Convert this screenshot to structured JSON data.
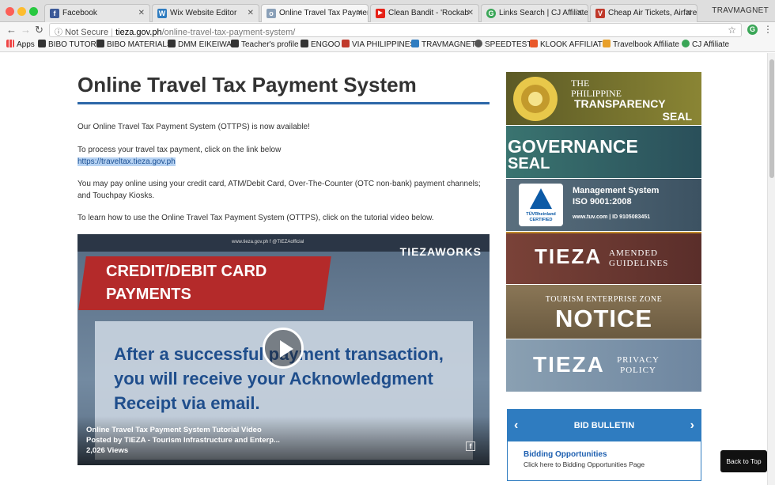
{
  "browser": {
    "tabs": [
      {
        "label": "Facebook",
        "favicon_color": "#3b5998",
        "favicon_glyph": "f"
      },
      {
        "label": "Wix Website Editor",
        "favicon_color": "#2f7cc0",
        "favicon_glyph": "W"
      },
      {
        "label": "Online Travel Tax Paymen",
        "favicon_color": "#8aa0b8",
        "favicon_glyph": "o",
        "active": true
      },
      {
        "label": "Clean Bandit - 'Rockab",
        "favicon_color": "#e62117",
        "favicon_glyph": "▶"
      },
      {
        "label": "Links Search | CJ Affiliate",
        "favicon_color": "#3aa657",
        "favicon_glyph": "G"
      },
      {
        "label": "Cheap Air Tickets, Airfare",
        "favicon_color": "#c0392b",
        "favicon_glyph": "V"
      }
    ],
    "profile_name": "TRAVMAGNET",
    "address": {
      "security": "Not Secure",
      "domain": "tieza.gov.ph",
      "path": "/online-travel-tax-payment-system/"
    },
    "bookmarks": [
      {
        "label": "Apps",
        "color": "#777"
      },
      {
        "label": "BIBO TUTOR",
        "color": "#333"
      },
      {
        "label": "BIBO MATERIALS",
        "color": "#333"
      },
      {
        "label": "DMM EIKEIWA",
        "color": "#333"
      },
      {
        "label": "Teacher's profile",
        "color": "#333"
      },
      {
        "label": "ENGOO",
        "color": "#333"
      },
      {
        "label": "VIA PHILIPPINES",
        "color": "#c0392b"
      },
      {
        "label": "TRAVMAGNET",
        "color": "#2f7cc0"
      },
      {
        "label": "SPEEDTEST",
        "color": "#555"
      },
      {
        "label": "KLOOK AFFILIATE",
        "color": "#e8582a"
      },
      {
        "label": "Travelbook Affiliate",
        "color": "#e8a02a"
      },
      {
        "label": "CJ Affiliate",
        "color": "#3aa657"
      }
    ]
  },
  "page": {
    "title": "Online Travel Tax Payment System",
    "paragraphs": {
      "p1": "Our Online Travel Tax Payment System (OTTPS) is now available!",
      "p2": "To process your travel tax payment, click on the link below",
      "link": "https://traveltax.tieza.gov.ph",
      "p3": "You may pay online using your credit card, ATM/Debit Card, Over-The-Counter (OTC non-bank) payment channels; and Touchpay Kiosks.",
      "p4": "To learn how to use the Online Travel Tax Payment System (OTTPS), click on the tutorial video below."
    },
    "video": {
      "topbar": "www.tieza.gov.ph    f  @TIEZAofficial",
      "logo": "TIEZAWORKS",
      "banner": "CREDIT/DEBIT CARD PAYMENTS",
      "body_text": "After a successful payment transaction, you will receive your Acknowledgment Receipt via email.",
      "caption_title": "Online Travel Tax Payment System Tutorial Video",
      "caption_by": "Posted by TIEZA - Tourism Infrastructure and Enterp...",
      "caption_views": "2,026 Views"
    }
  },
  "sidebar": {
    "banners": [
      {
        "name": "transparency-seal",
        "line1": "THE PHILIPPINE",
        "line2": "TRANSPARENCY",
        "line3": "SEAL",
        "bg": "#6b6a2e"
      },
      {
        "name": "governance-seal",
        "line1": "GOVERNANCE",
        "line2": "SEAL",
        "bg": "#2f5f5a"
      },
      {
        "name": "iso-certification",
        "line1": "Management System",
        "line2": "ISO 9001:2008",
        "line3": "www.tuv.com  |  ID 9105083451",
        "badge": "TÜVRheinland CERTIFIED",
        "bg": "#4c6272"
      },
      {
        "name": "tieza-amended-guidelines",
        "line1": "TIEZA",
        "line2": "AMENDED GUIDELINES",
        "bg": "#6b3a34"
      },
      {
        "name": "tez-notice",
        "line1": "TOURISM ENTERPRISE ZONE",
        "line2": "NOTICE",
        "bg": "#7a6a4c"
      },
      {
        "name": "privacy-policy",
        "line1": "TIEZA",
        "line2": "PRIVACY POLICY",
        "bg": "#7c92a6"
      }
    ],
    "bid": {
      "heading": "BID BULLETIN",
      "item_title": "Bidding Opportunities",
      "item_sub": "Click here to Bidding Opportunities Page"
    }
  },
  "back_to_top": "Back to Top"
}
